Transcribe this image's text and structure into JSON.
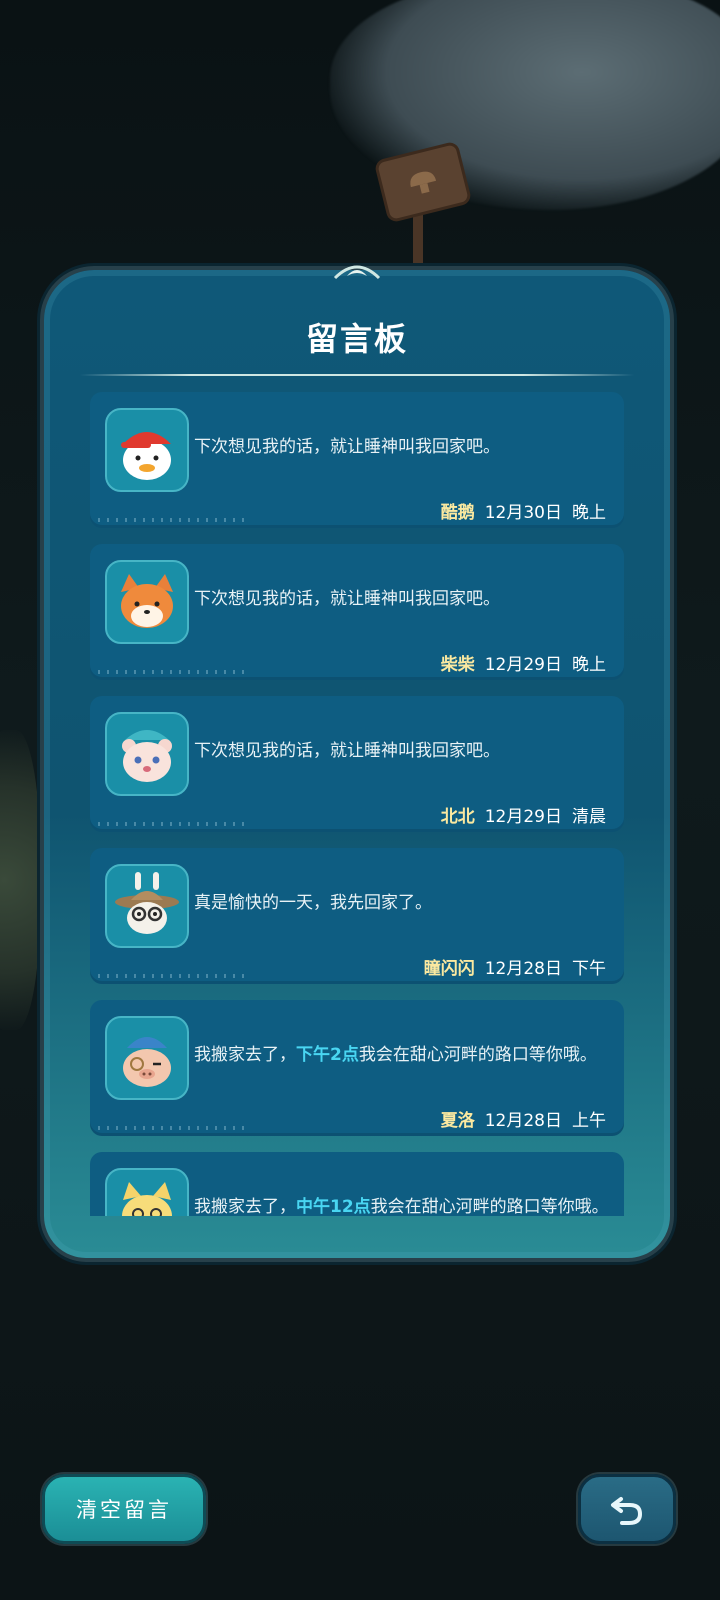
{
  "board": {
    "title": "留言板"
  },
  "messages": [
    {
      "avatar": "duck-avatar",
      "text": "下次想见我的话，就让睡神叫我回家吧。",
      "sender": "酷鹅",
      "date": "12月30日",
      "time": "晚上"
    },
    {
      "avatar": "shiba-avatar",
      "text": "下次想见我的话，就让睡神叫我回家吧。",
      "sender": "柴柴",
      "date": "12月29日",
      "time": "晚上"
    },
    {
      "avatar": "bear-avatar",
      "text": "下次想见我的话，就让睡神叫我回家吧。",
      "sender": "北北",
      "date": "12月29日",
      "time": "清晨"
    },
    {
      "avatar": "rabbit-hat-avatar",
      "text": "真是愉快的一天，我先回家了。",
      "sender": "瞳闪闪",
      "date": "12月28日",
      "time": "下午"
    },
    {
      "avatar": "pig-avatar",
      "text_before": "我搬家去了，",
      "highlight": "下午2点",
      "text_after": "我会在甜心河畔的路口等你哦。",
      "sender": "夏洛",
      "date": "12月28日",
      "time": "上午"
    },
    {
      "avatar": "cat-avatar",
      "text_before": "我搬家去了，",
      "highlight": "中午12点",
      "text_after": "我会在甜心河畔的路口等你哦。"
    }
  ],
  "buttons": {
    "clear_label": "清空留言",
    "back_icon": "undo-arrow-icon"
  },
  "colors": {
    "board": "#0f5878",
    "card": "#0e5d82",
    "sender": "#fbe9a0",
    "highlight": "#49d6f2",
    "clear_button": "#2ab3b3"
  }
}
